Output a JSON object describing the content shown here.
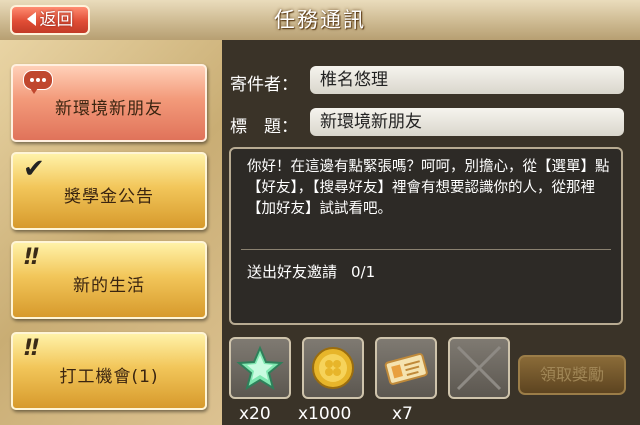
{
  "header": {
    "title": "任務通訊",
    "back_label": "返回"
  },
  "missions": [
    {
      "label": "新環境新朋友",
      "status": "message",
      "active": true
    },
    {
      "label": "獎學金公告",
      "status": "completed",
      "active": false
    },
    {
      "label": "新的生活",
      "status": "new",
      "active": false
    },
    {
      "label": "打工機會(1)",
      "status": "new",
      "active": false
    }
  ],
  "detail": {
    "sender_label": "寄件者：",
    "sender_value": "椎名悠理",
    "subject_label": "標　題：",
    "subject_value": "新環境新朋友",
    "message": "你好！在這邊有點緊張嗎？呵呵，別擔心，從【選單】點【好友】，【搜尋好友】裡會有想要認識你的人，從那裡【加好友】試試看吧。",
    "progress_label": "送出好友邀請",
    "progress_value": "0/1"
  },
  "rewards": [
    {
      "icon": "star-icon",
      "count": "x20"
    },
    {
      "icon": "gold-coin-icon",
      "count": "x1000"
    },
    {
      "icon": "ticket-icon",
      "count": "x7"
    },
    {
      "icon": "empty-slot-icon",
      "count": ""
    }
  ],
  "claim_button_label": "領取獎勵",
  "colors": {
    "accent_red": "#e04d35",
    "gold": "#f2c65a",
    "panel_dark": "#3a3328"
  }
}
